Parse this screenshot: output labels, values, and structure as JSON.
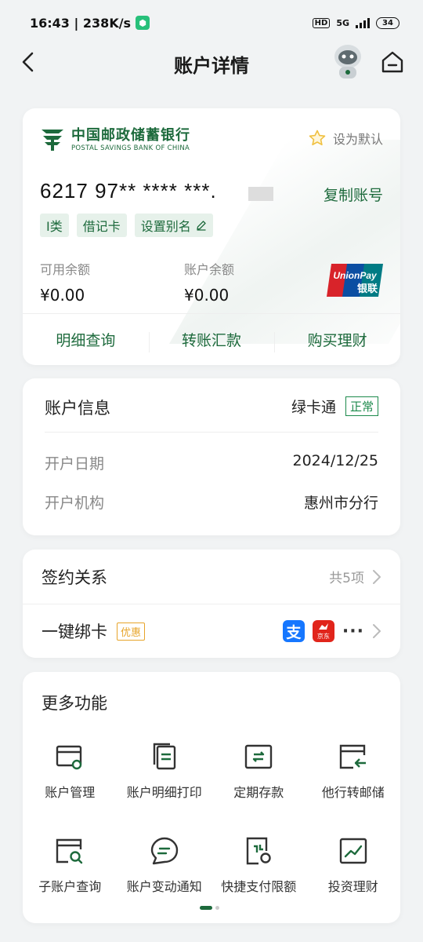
{
  "status_bar": {
    "time_speed": "16:43 | 238K/s",
    "network": "HD",
    "signal_label": "5G",
    "battery": "34"
  },
  "nav": {
    "title": "账户详情"
  },
  "bank_card": {
    "bank_name_cn": "中国邮政储蓄银行",
    "bank_name_en": "POSTAL SAVINGS BANK OF CHINA",
    "set_default_label": "设为默认",
    "account_number": "6217 97** **** ***.",
    "copy_label": "复制账号",
    "tags": [
      "I类",
      "借记卡",
      "设置别名"
    ],
    "available_label": "可用余额",
    "available_value": "¥0.00",
    "balance_label": "账户余额",
    "balance_value": "¥0.00",
    "unionpay_label": "UnionPay",
    "unionpay_cn": "银联",
    "actions": [
      "明细查询",
      "转账汇款",
      "购买理财"
    ]
  },
  "account_info": {
    "title": "账户信息",
    "card_type": "绿卡通",
    "status": "正常",
    "rows": [
      {
        "key": "开户日期",
        "value": "2024/12/25"
      },
      {
        "key": "开户机构",
        "value": "惠州市分行"
      }
    ]
  },
  "sign": {
    "relation_label": "签约关系",
    "relation_count": "共5项",
    "bind_label": "一键绑卡",
    "promo": "优惠",
    "alipay_glyph": "支",
    "jd_label": "京东",
    "more": "···"
  },
  "more_functions": {
    "title": "更多功能",
    "items": [
      {
        "label": "账户管理",
        "icon": "account-manage-icon"
      },
      {
        "label": "账户明细打印",
        "icon": "print-detail-icon"
      },
      {
        "label": "定期存款",
        "icon": "fixed-deposit-icon"
      },
      {
        "label": "他行转邮储",
        "icon": "transfer-in-icon"
      },
      {
        "label": "子账户查询",
        "icon": "sub-account-search-icon"
      },
      {
        "label": "账户变动通知",
        "icon": "chat-notify-icon"
      },
      {
        "label": "快捷支付限额",
        "icon": "quick-pay-limit-icon"
      },
      {
        "label": "投资理财",
        "icon": "investment-chart-icon"
      }
    ]
  },
  "colors": {
    "brand_green": "#1d6a3c",
    "status_green": "#1d8a4c",
    "promo_orange": "#e7a42a",
    "background": "#f1f3f4"
  }
}
